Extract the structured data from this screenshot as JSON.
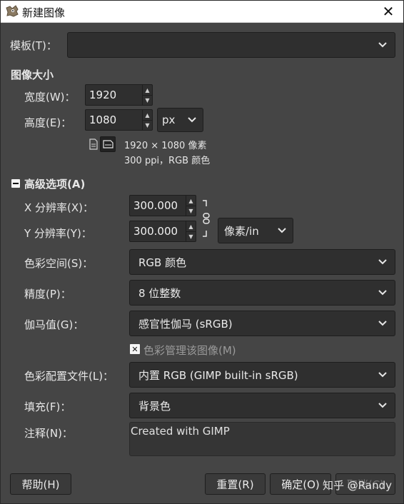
{
  "window": {
    "title": "新建图像",
    "close_icon": "close-icon"
  },
  "template": {
    "label": "模板(T)：",
    "value": ""
  },
  "image_size": {
    "heading": "图像大小",
    "width_label": "宽度(W)：",
    "width_value": "1920",
    "height_label": "高度(E)：",
    "height_value": "1080",
    "unit": "px",
    "info_line1": "1920 × 1080 像素",
    "info_line2": "300 ppi，RGB 颜色"
  },
  "advanced": {
    "heading": "高级选项(A)",
    "x_res_label": "X 分辨率(X)：",
    "x_res_value": "300.000",
    "y_res_label": "Y 分辨率(Y)：",
    "y_res_value": "300.000",
    "res_unit": "像素/in",
    "color_space_label": "色彩空间(S)：",
    "color_space_value": "RGB 颜色",
    "precision_label": "精度(P)：",
    "precision_value": "8 位整数",
    "gamma_label": "伽马值(G)：",
    "gamma_value": "感官性伽马 (sRGB)",
    "color_manage_label": "色彩管理该图像(M)",
    "profile_label": "色彩配置文件(L)：",
    "profile_value": "内置 RGB (GIMP built-in sRGB)",
    "fill_label": "填充(F)：",
    "fill_value": "背景色",
    "comment_label": "注释(N)：",
    "comment_value": "Created with GIMP"
  },
  "buttons": {
    "help": "帮助(H)",
    "reset": "重置(R)",
    "ok": "确定(O)",
    "cancel": "取消(C)"
  },
  "watermark": "知乎 @Randy",
  "colors": {
    "bg": "#454545",
    "field": "#2f2f2f",
    "titlebar": "#ffffff"
  }
}
